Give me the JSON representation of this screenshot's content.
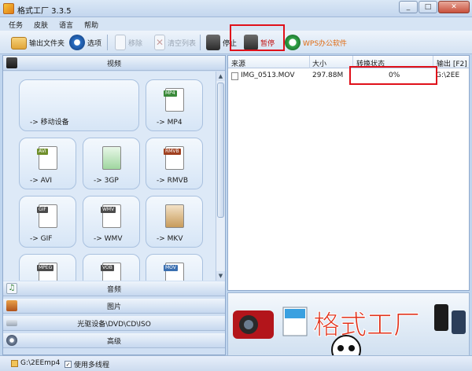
{
  "window": {
    "title": "格式工厂 3.3.5"
  },
  "menu": [
    "任务",
    "皮肤",
    "语言",
    "帮助"
  ],
  "toolbar": {
    "output_folder": "输出文件夹",
    "options": "选项",
    "remove": "移除",
    "clear_list": "清空列表",
    "stop": "停止",
    "pause": "暂停",
    "wps": "WPS办公软件"
  },
  "sections": {
    "video": "视频",
    "audio": "音频",
    "image": "图片",
    "disc": "光驱设备\\DVD\\CD\\ISO",
    "advanced": "高级"
  },
  "video_tiles": [
    {
      "label": "-> 移动设备",
      "icon": "mobile-device-icon"
    },
    {
      "label": "-> MP4",
      "icon": "mp4-file-icon",
      "tag": "MP4",
      "tag_color": "#3a8a3a"
    },
    {
      "label": "-> AVI",
      "icon": "avi-file-icon",
      "tag": "AVI",
      "tag_color": "#6f8f2a"
    },
    {
      "label": "-> 3GP",
      "icon": "3gp-file-icon",
      "tag": "",
      "tag_color": "#3a8a3a"
    },
    {
      "label": "-> RMVB",
      "icon": "rmvb-file-icon",
      "tag": "RMVB",
      "tag_color": "#a04020"
    },
    {
      "label": "-> GIF",
      "icon": "gif-file-icon",
      "tag": "GIF",
      "tag_color": "#4b4b4b"
    },
    {
      "label": "-> WMV",
      "icon": "wmv-file-icon",
      "tag": "WMV",
      "tag_color": "#4b4b4b"
    },
    {
      "label": "-> MKV",
      "icon": "mkv-file-icon",
      "tag": "",
      "tag_color": "#8b6a3a"
    },
    {
      "label": "",
      "icon": "mpeg-file-icon",
      "tag": "MPEG",
      "tag_color": "#4b4b4b"
    },
    {
      "label": "",
      "icon": "vob-file-icon",
      "tag": "VOB",
      "tag_color": "#4b4b4b"
    },
    {
      "label": "",
      "icon": "mov-file-icon",
      "tag": "MOV",
      "tag_color": "#3a6fb0"
    }
  ],
  "table": {
    "headers": {
      "source": "来源",
      "size": "大小",
      "status": "转换状态",
      "output": "输出 [F2]"
    },
    "rows": [
      {
        "source": "IMG_0513.MOV",
        "size": "297.88M",
        "status": "0%",
        "output": "G:\\2EE"
      }
    ]
  },
  "status": {
    "output_path": "G:\\2EEmp4",
    "multithread_label": "使用多线程",
    "multithread_checked": "✓"
  },
  "colors": {
    "highlight": "#e0101a",
    "accent": "#1e5fb4"
  }
}
